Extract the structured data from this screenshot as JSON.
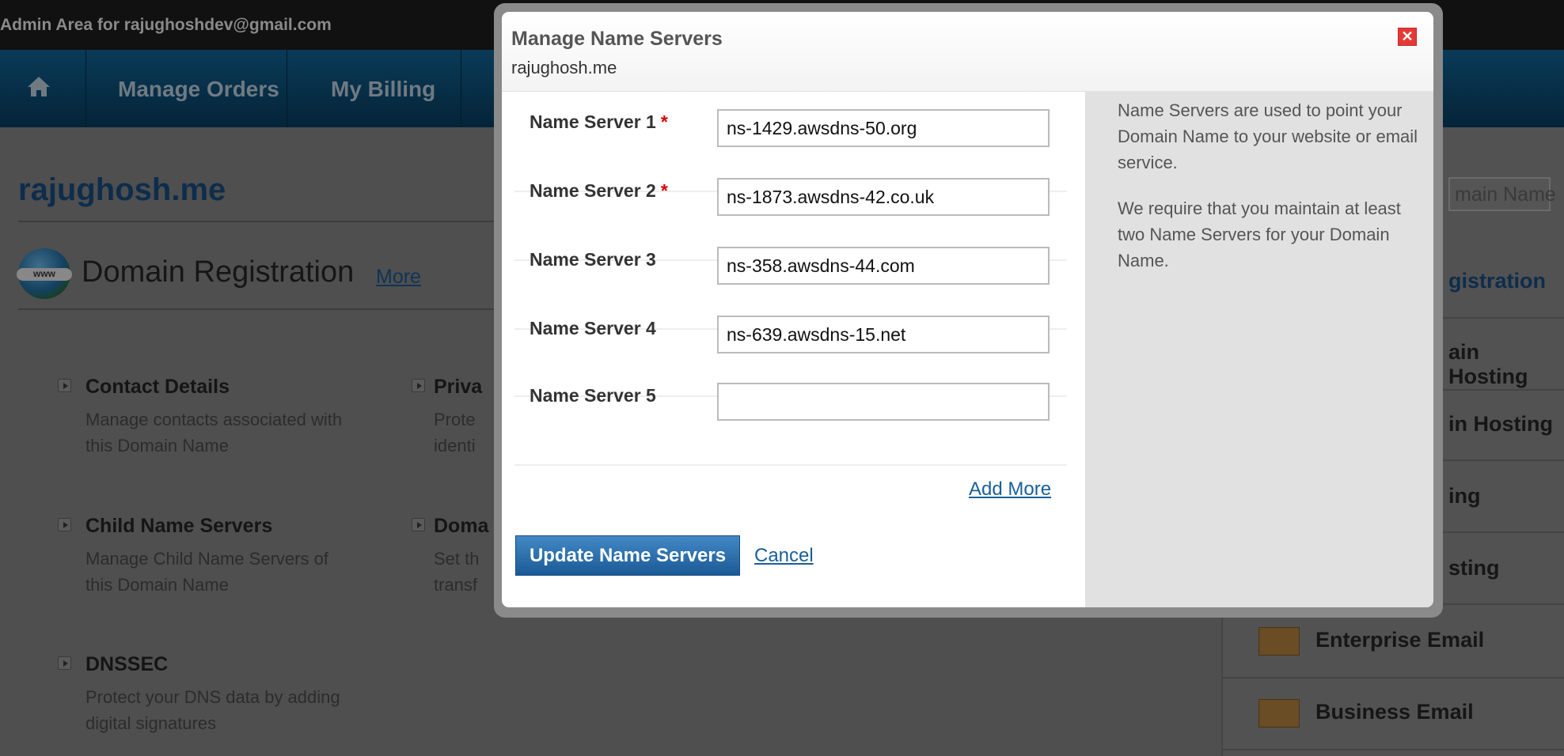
{
  "topbar": {
    "text": "Admin Area for rajughoshdev@gmail.com"
  },
  "nav": {
    "home_icon": "home-icon",
    "items": [
      "Manage Orders",
      "My Billing"
    ]
  },
  "page": {
    "domain": "rajughosh.me",
    "section_title": "Domain Registration",
    "more_link": "More",
    "items": [
      {
        "title": "Contact Details",
        "desc1": "Manage contacts associated with",
        "desc2": "this Domain Name"
      },
      {
        "title": "Priva",
        "desc1": "Prote",
        "desc2": "identi"
      },
      {
        "title": "Child Name Servers",
        "desc1": "Manage Child Name Servers of",
        "desc2": "this Domain Name"
      },
      {
        "title": "Doma",
        "desc1": "Set th",
        "desc2": "transf"
      },
      {
        "title": "DNSSEC",
        "desc1": "Protect your DNS data by adding",
        "desc2": "digital signatures"
      }
    ]
  },
  "sidebar": {
    "search_placeholder": "main Name",
    "items": [
      "gistration",
      "ain Hosting",
      "in Hosting",
      "ing",
      "sting",
      "Enterprise Email",
      "Business Email"
    ]
  },
  "modal": {
    "title": "Manage Name Servers",
    "subtitle": "rajughosh.me",
    "close_icon": "close-icon",
    "fields": [
      {
        "label": "Name Server 1",
        "required": "*",
        "value": "ns-1429.awsdns-50.org"
      },
      {
        "label": "Name Server 2",
        "required": "*",
        "value": "ns-1873.awsdns-42.co.uk"
      },
      {
        "label": "Name Server 3",
        "value": "ns-358.awsdns-44.com"
      },
      {
        "label": "Name Server 4",
        "value": "ns-639.awsdns-15.net"
      },
      {
        "label": "Name Server 5",
        "value": ""
      }
    ],
    "add_more": "Add More",
    "update_button": "Update Name Servers",
    "cancel": "Cancel",
    "help": [
      "Name Servers are used to point your Domain Name to your website or email service.",
      "We require that you maintain at least two Name Servers for your Domain Name."
    ]
  },
  "colors": {
    "accent": "#1a5f9a",
    "nav": "#0d5f98",
    "close": "#e53935",
    "required": "#dd0000"
  }
}
